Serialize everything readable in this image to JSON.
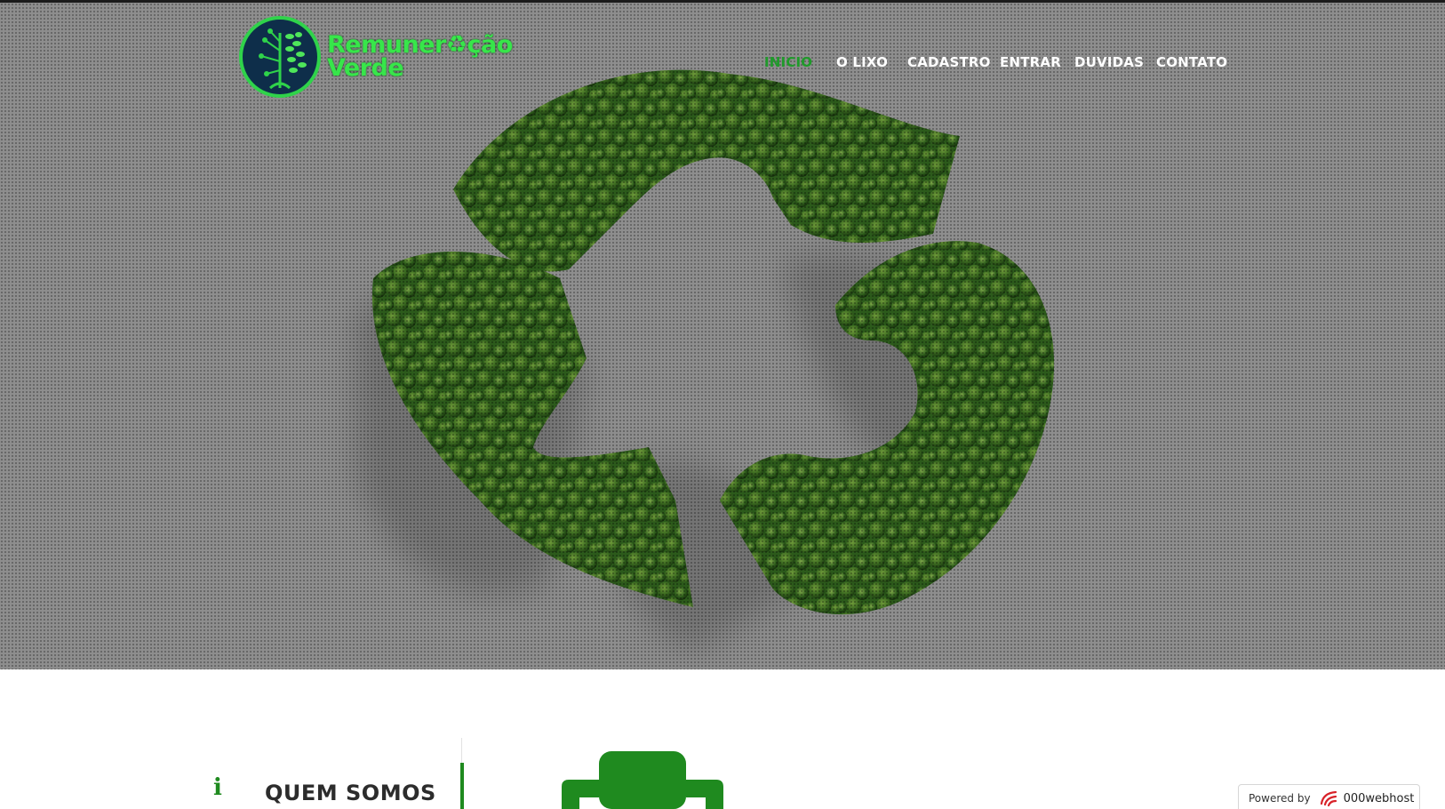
{
  "colors": {
    "hero_background": "#8e8e8e",
    "brand_green": "#37e64a",
    "accent_green": "#1f8a1f",
    "nav_active": "#1f9a2a",
    "nav_text": "#ffffff",
    "title_text": "#2c2c2c"
  },
  "logo": {
    "line1": "Remuner♻ção",
    "line2": "Verde",
    "emblem_icon": "circuit-tree-icon"
  },
  "hero": {
    "image": "recycle-symbol-made-of-trees"
  },
  "nav": {
    "items": [
      {
        "label": "INICIO",
        "active": true
      },
      {
        "label": "O LIXO",
        "active": false
      },
      {
        "label": "CADASTRO",
        "active": false
      },
      {
        "label": "ENTRAR",
        "active": false
      },
      {
        "label": "DUVIDAS",
        "active": false
      },
      {
        "label": "CONTATO",
        "active": false
      }
    ]
  },
  "about": {
    "icon": "info-icon",
    "icon_glyph": "i",
    "title": "QUEM SOMOS",
    "graphic": "trophy-icon"
  },
  "badge": {
    "powered_label": "Powered by",
    "brand": "000webhost",
    "icon": "000webhost-logo-icon"
  }
}
